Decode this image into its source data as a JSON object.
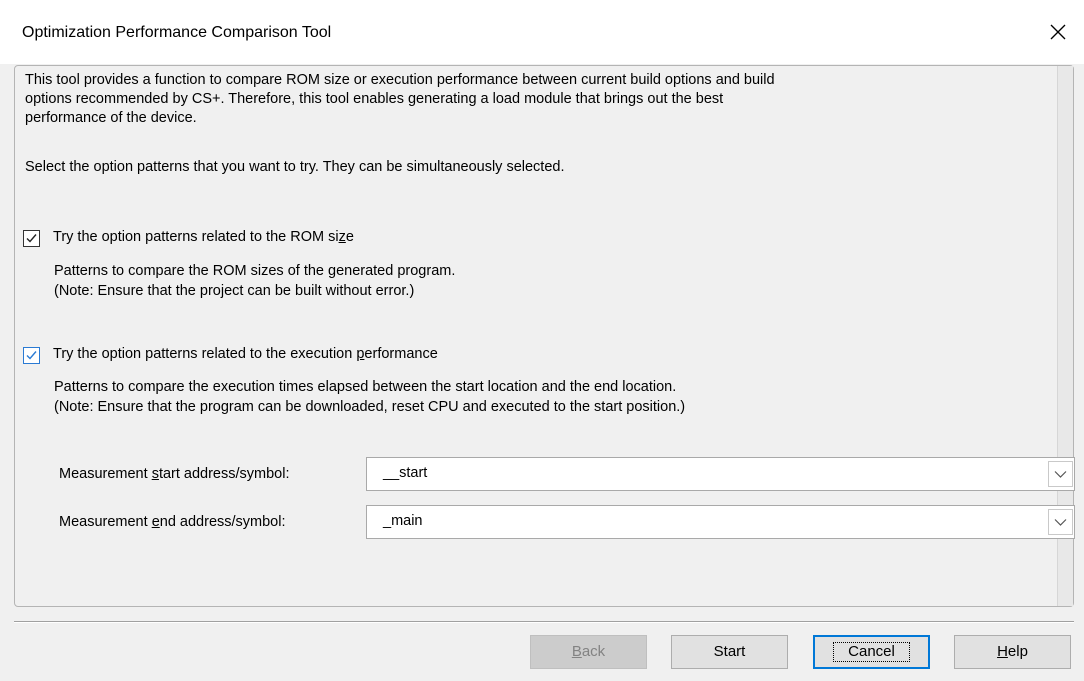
{
  "window": {
    "title": "Optimization Performance Comparison Tool",
    "close_symbol": "×"
  },
  "intro": {
    "text": "This tool provides a function to compare ROM size or execution performance between current build options and build\noptions recommended by CS+. Therefore, this tool enables generating a load module that brings out the best\nperformance of the device.",
    "select_prompt": "Select the option patterns that you want to try. They can be simultaneously selected."
  },
  "options": {
    "rom": {
      "checked": true,
      "label_pre": "Try the option patterns related to the ROM si",
      "label_accel": "z",
      "label_post": "e",
      "description": "Patterns to compare the ROM sizes of the generated program.\n(Note: Ensure that the project can be built without error.)"
    },
    "exec": {
      "checked": true,
      "label_pre": "Try the option patterns related to the execution ",
      "label_accel": "p",
      "label_post": "erformance",
      "description": "Patterns to compare the execution times elapsed between the start location and the end location.\n(Note: Ensure that the program can be downloaded, reset CPU and executed to the start position.)"
    }
  },
  "fields": {
    "start": {
      "label_pre": "Measurement ",
      "label_accel": "s",
      "label_post": "tart address/symbol:",
      "value": "__start"
    },
    "end": {
      "label_pre": "Measurement ",
      "label_accel": "e",
      "label_post": "nd address/symbol:",
      "value": "_main"
    }
  },
  "buttons": {
    "back": {
      "accel": "B",
      "rest": "ack",
      "enabled": false
    },
    "start": {
      "label": "Start"
    },
    "cancel": {
      "label": "Cancel"
    },
    "help": {
      "accel": "H",
      "rest": "elp"
    }
  },
  "colors": {
    "dialog_bg": "#f0f0f0",
    "focus_blue": "#0078d7",
    "checkbox_focus": "#2a7ad3"
  },
  "icons": {
    "close": "close-icon",
    "check": "checkmark-icon",
    "dropdown": "chevron-down-icon"
  }
}
